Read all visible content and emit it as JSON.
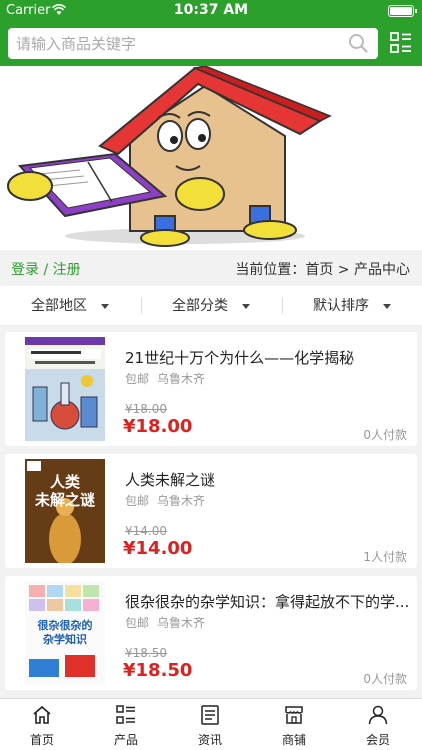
{
  "status_bar": {
    "carrier": "Carrier",
    "time": "10:37 AM"
  },
  "search": {
    "placeholder": "请输入商品关键字"
  },
  "crumb": {
    "login": "登录 / 注册",
    "location": "当前位置：首页 > 产品中心"
  },
  "filters": [
    {
      "label": "全部地区"
    },
    {
      "label": "全部分类"
    },
    {
      "label": "默认排序"
    }
  ],
  "products": [
    {
      "title": "21世纪十万个为什么——化学揭秘",
      "shipping": "包邮",
      "location": "乌鲁木齐",
      "old_price": "¥18.00",
      "price": "¥18.00",
      "sold": "0人付款"
    },
    {
      "title": "人类未解之谜",
      "shipping": "包邮",
      "location": "乌鲁木齐",
      "old_price": "¥14.00",
      "price": "¥14.00",
      "sold": "1人付款"
    },
    {
      "title": "很杂很杂的杂学知识：拿得起放不下的学...",
      "shipping": "包邮",
      "location": "乌鲁木齐",
      "old_price": "¥18.50",
      "price": "¥18.50",
      "sold": "0人付款"
    }
  ],
  "book_covers": {
    "cover2_title_line1": "人类",
    "cover2_title_line2": "未解之谜",
    "cover3_title_line1": "很杂很杂的",
    "cover3_title_line2": "杂学知识"
  },
  "tabs": [
    {
      "label": "首页",
      "icon": "home-icon"
    },
    {
      "label": "产品",
      "icon": "list-icon"
    },
    {
      "label": "资讯",
      "icon": "news-icon"
    },
    {
      "label": "商铺",
      "icon": "shop-icon"
    },
    {
      "label": "会员",
      "icon": "member-icon"
    }
  ],
  "colors": {
    "brand_green": "#2ba02b",
    "price_red": "#e0201e"
  }
}
